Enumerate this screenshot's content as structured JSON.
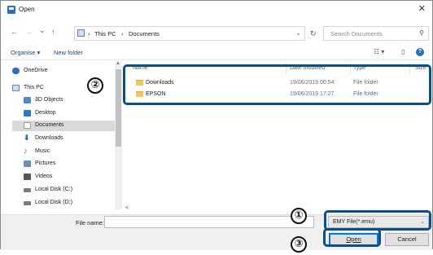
{
  "window": {
    "title": "Open",
    "close_glyph": "✕"
  },
  "address": {
    "back": "←",
    "forward": "→",
    "dropdown": "⌄",
    "up": "↑",
    "crumbs": [
      "This PC",
      "Documents"
    ],
    "separator": "›",
    "chevron": "⌄",
    "refresh": "↻",
    "search_placeholder": "Search Documents",
    "search_icon_glyph": "⚲"
  },
  "toolbar": {
    "organise": "Organise ▾",
    "new_folder": "New folder",
    "view_glyph": "☷ ▾",
    "pane_glyph": "▯",
    "help_glyph": "?"
  },
  "navpane": {
    "items": [
      {
        "label": "OneDrive",
        "icon": "cloud-icon",
        "color": "#2b6cc4"
      },
      {
        "label": "This PC",
        "icon": "computer-icon",
        "color": "#5b7fae"
      },
      {
        "label": "3D Objects",
        "icon": "cube-icon",
        "color": "#4c8ac9"
      },
      {
        "label": "Desktop",
        "icon": "desktop-icon",
        "color": "#2b78c8"
      },
      {
        "label": "Documents",
        "icon": "document-icon",
        "color": "#b7b7b7"
      },
      {
        "label": "Downloads",
        "icon": "download-icon",
        "color": "#2b6cc4"
      },
      {
        "label": "Music",
        "icon": "music-icon",
        "color": "#2b6cc4"
      },
      {
        "label": "Pictures",
        "icon": "pictures-icon",
        "color": "#6b8fb8"
      },
      {
        "label": "Videos",
        "icon": "video-icon",
        "color": "#555555"
      },
      {
        "label": "Local Disk (C:)",
        "icon": "drive-icon",
        "color": "#7a7a7a"
      },
      {
        "label": "Local Disk (D:)",
        "icon": "drive-icon",
        "color": "#7a7a7a"
      }
    ]
  },
  "filelist": {
    "columns": {
      "name": "Name",
      "date": "Date modified",
      "type": "Type",
      "size": "Size"
    },
    "rows": [
      {
        "name": "Downloads",
        "date": "19/06/2019 00:54",
        "type": "File folder"
      },
      {
        "name": "EPSON",
        "date": "19/06/2019 17:27",
        "type": "File folder"
      }
    ],
    "hscroll_arrow": "<"
  },
  "bottom": {
    "filename_label": "File name:",
    "filename_value": "",
    "filter_value": "EMY File(*.emu)",
    "filter_chevron": "⌄",
    "open_label": "Open",
    "cancel_label": "Cancel"
  },
  "callouts": {
    "one": "①",
    "two": "②",
    "three": "③"
  },
  "colors": {
    "highlight": "#0b4f8a",
    "selected_row": "#d9d9d9",
    "folder": "#f4c65a"
  }
}
